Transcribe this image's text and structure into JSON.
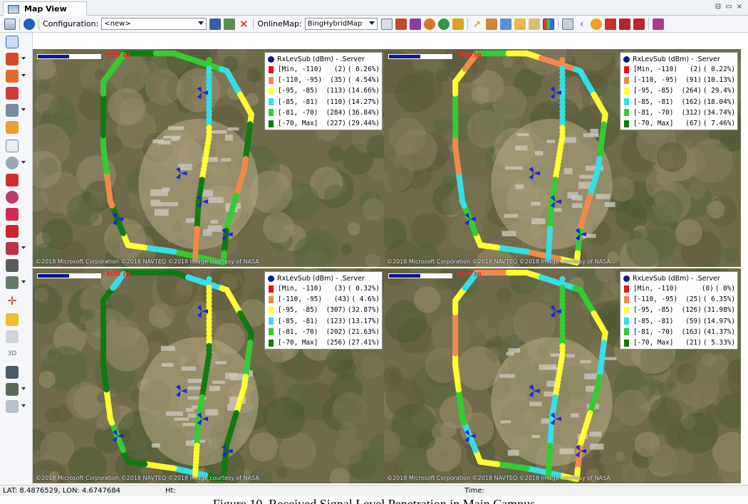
{
  "window": {
    "tab_title": "Map View",
    "controls": [
      "⊟",
      "▭",
      "×"
    ]
  },
  "toolbar": {
    "configuration_label": "Configuration:",
    "configuration_value": "<new>",
    "online_map_label": "OnlineMap:",
    "online_map_value": "BingHybridMap"
  },
  "maps": [
    {
      "scale_label": "400 m",
      "copyright": "©2018 Microsoft Corporation  ©2018 NAVTEQ  ©2018 Image courtesy of NASA",
      "legend": {
        "title": "RxLevSub (dBm) - .Server",
        "rows": [
          {
            "range": "[Min, -110)",
            "count": "(2)",
            "pct": "( 0.26%)",
            "color": "#e41414"
          },
          {
            "range": "[-110, -95)",
            "count": "(35)",
            "pct": "( 4.54%)",
            "color": "#f08a4b"
          },
          {
            "range": "[-95, -85)",
            "count": "(113)",
            "pct": "(14.66%)",
            "color": "#ffff33"
          },
          {
            "range": "[-85, -81)",
            "count": "(110)",
            "pct": "(14.27%)",
            "color": "#33e0e8"
          },
          {
            "range": "[-81, -70)",
            "count": "(284)",
            "pct": "(36.84%)",
            "color": "#33cc33"
          },
          {
            "range": "[-70, Max]",
            "count": "(227)",
            "pct": "(29.44%)",
            "color": "#117a11"
          }
        ]
      }
    },
    {
      "scale_label": "400 m",
      "copyright": "©2018 Microsoft Corporation  ©2018 NAVTEQ  ©2018 Image courtesy of NASA",
      "legend": {
        "title": "RxLevSub (dBm) - .Server",
        "rows": [
          {
            "range": "[Min, -110)",
            "count": "(2)",
            "pct": "( 0.22%)",
            "color": "#e41414"
          },
          {
            "range": "[-110, -95)",
            "count": "(91)",
            "pct": "(10.13%)",
            "color": "#f08a4b"
          },
          {
            "range": "[-95, -85)",
            "count": "(264)",
            "pct": "( 29.4%)",
            "color": "#ffff33"
          },
          {
            "range": "[-85, -81)",
            "count": "(162)",
            "pct": "(18.04%)",
            "color": "#33e0e8"
          },
          {
            "range": "[-81, -70)",
            "count": "(312)",
            "pct": "(34.74%)",
            "color": "#33cc33"
          },
          {
            "range": "[-70, Max]",
            "count": "(67)",
            "pct": "( 7.46%)",
            "color": "#117a11"
          }
        ]
      }
    },
    {
      "scale_label": "400 m",
      "copyright": "©2018 Microsoft Corporation  ©2018 NAVTEQ  ©2018 Image courtesy of NASA",
      "legend": {
        "title": "RxLevSub (dBm) - .Server",
        "rows": [
          {
            "range": "[Min, -110)",
            "count": "(3)",
            "pct": "( 0.32%)",
            "color": "#e41414"
          },
          {
            "range": "[-110, -95)",
            "count": "(43)",
            "pct": "(  4.6%)",
            "color": "#f08a4b"
          },
          {
            "range": "[-95, -85)",
            "count": "(307)",
            "pct": "(32.87%)",
            "color": "#ffff33"
          },
          {
            "range": "[-85, -81)",
            "count": "(123)",
            "pct": "(13.17%)",
            "color": "#33e0e8"
          },
          {
            "range": "[-81, -70)",
            "count": "(202)",
            "pct": "(21.63%)",
            "color": "#33cc33"
          },
          {
            "range": "[-70, Max]",
            "count": "(256)",
            "pct": "(27.41%)",
            "color": "#117a11"
          }
        ]
      }
    },
    {
      "scale_label": "400 m",
      "copyright": "©2018 Microsoft Corporation  ©2018 NAVTEQ  ©2018 Image courtesy of NASA",
      "legend": {
        "title": "RxLevSub (dBm) - .Server",
        "rows": [
          {
            "range": "[Min, -110)",
            "count": "(0)",
            "pct": "(    0%)",
            "color": "#e41414"
          },
          {
            "range": "[-110, -95)",
            "count": "(25)",
            "pct": "( 6.35%)",
            "color": "#f08a4b"
          },
          {
            "range": "[-95, -85)",
            "count": "(126)",
            "pct": "(31.98%)",
            "color": "#ffff33"
          },
          {
            "range": "[-85, -81)",
            "count": "(59)",
            "pct": "(14.97%)",
            "color": "#33e0e8"
          },
          {
            "range": "[-81, -70)",
            "count": "(163)",
            "pct": "(41.37%)",
            "color": "#33cc33"
          },
          {
            "range": "[-70, Max]",
            "count": "(21)",
            "pct": "( 5.33%)",
            "color": "#117a11"
          }
        ]
      }
    }
  ],
  "statusbar": {
    "coords": "LAT: 8.4876529, LON: 4.6747684",
    "ht": "Ht:",
    "time": "Time:"
  },
  "caption": "Figure 10. Received Signal Level Penetration in Main Campus"
}
